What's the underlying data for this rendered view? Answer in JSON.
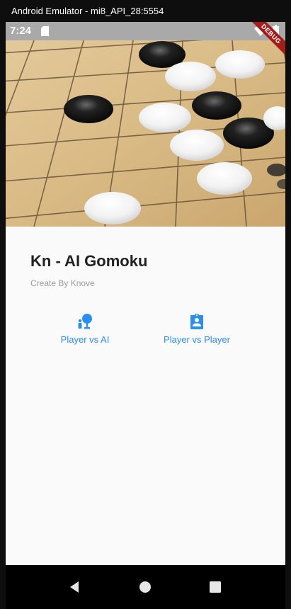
{
  "window": {
    "title": "Android Emulator - mi8_API_28:5554"
  },
  "statusbar": {
    "time": "7:24",
    "debug_label": "DEBUG"
  },
  "app": {
    "title": "Kn - AI Gomoku",
    "subtitle": "Create By Knove"
  },
  "modes": [
    {
      "label": "Player vs AI",
      "icon": "person-vs-ai-icon"
    },
    {
      "label": "Player vs Player",
      "icon": "contact-badge-icon"
    }
  ],
  "colors": {
    "accent": "#2b8ff0",
    "statusbar": "#a9a9a9",
    "debug_banner": "#a41d1d",
    "background": "#fafafa"
  },
  "navbar": {
    "items": [
      "back-icon",
      "home-icon",
      "recents-icon"
    ]
  }
}
